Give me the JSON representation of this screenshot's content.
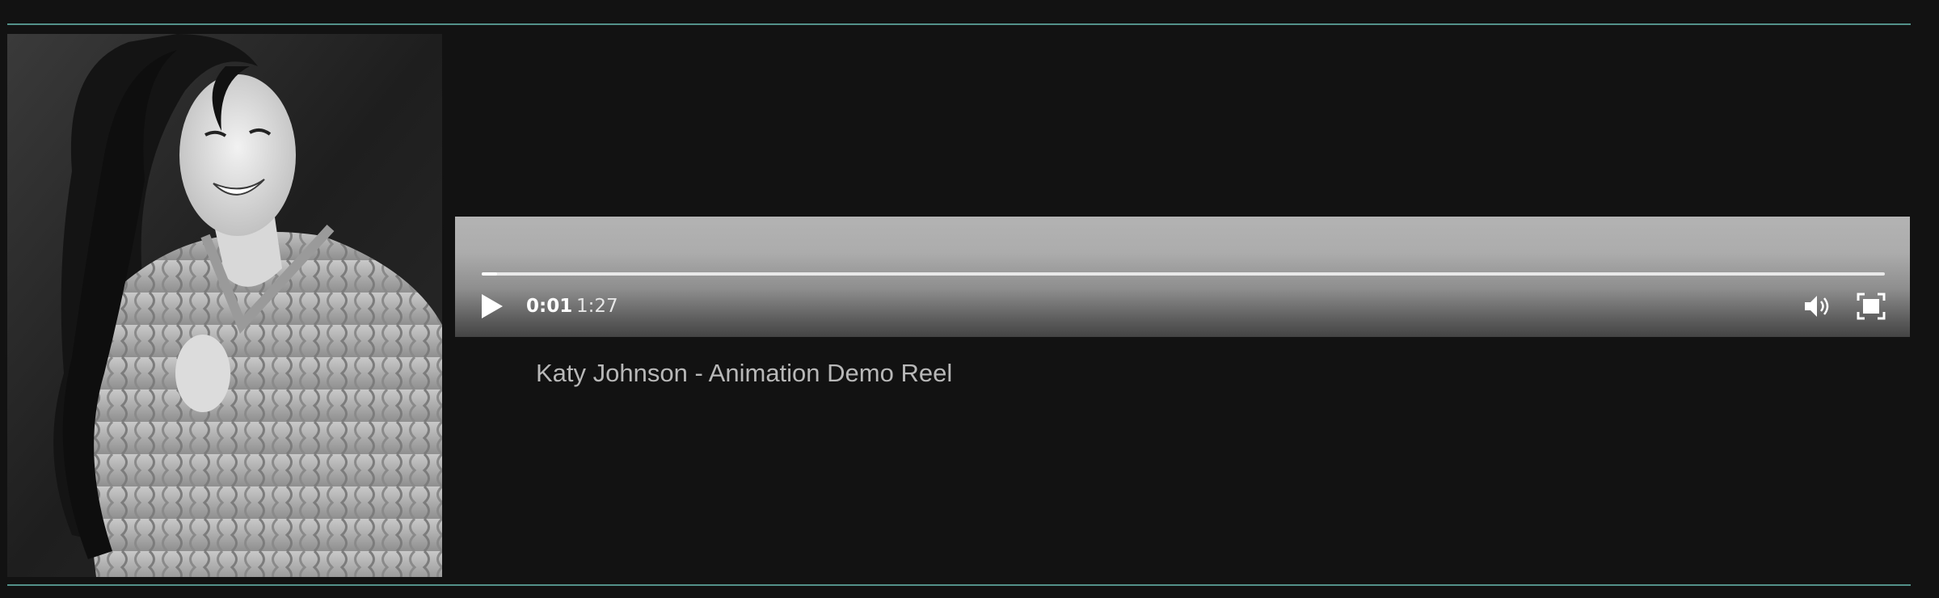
{
  "portrait": {
    "alt": "Black and white portrait photo"
  },
  "video": {
    "current_time": "0:01",
    "duration": "1:27",
    "progress": 0.011,
    "icons": {
      "play": "play-icon",
      "volume": "volume-icon",
      "fullscreen": "fullscreen-icon"
    }
  },
  "caption": "Katy Johnson - Animation Demo Reel",
  "colors": {
    "background": "#121212",
    "rule": "#5fa8a0",
    "caption": "#b8b8b8"
  }
}
